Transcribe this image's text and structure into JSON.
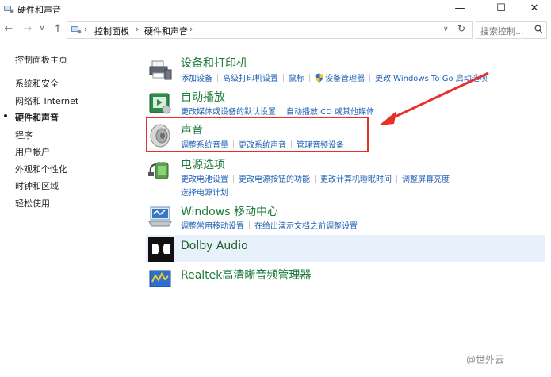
{
  "window": {
    "title": "硬件和声音"
  },
  "address": {
    "crumbs": [
      "控制面板",
      "硬件和声音"
    ]
  },
  "search": {
    "placeholder": "搜索控制..."
  },
  "sidebar": {
    "items": [
      {
        "label": "控制面板主页"
      },
      {
        "label": "系统和安全"
      },
      {
        "label": "网络和 Internet"
      },
      {
        "label": "硬件和声音"
      },
      {
        "label": "程序"
      },
      {
        "label": "用户帐户"
      },
      {
        "label": "外观和个性化"
      },
      {
        "label": "时钟和区域"
      },
      {
        "label": "轻松使用"
      }
    ]
  },
  "categories": {
    "devices": {
      "title": "设备和打印机",
      "links": [
        "添加设备",
        "高级打印机设置",
        "鼠标",
        "设备管理器",
        "更改 Windows To Go 启动选项"
      ]
    },
    "autoplay": {
      "title": "自动播放",
      "links": [
        "更改媒体或设备的默认设置",
        "自动播放 CD 或其他媒体"
      ]
    },
    "sound": {
      "title": "声音",
      "links": [
        "调整系统音量",
        "更改系统声音",
        "管理音频设备"
      ]
    },
    "power": {
      "title": "电源选项",
      "links": [
        "更改电池设置",
        "更改电源按钮的功能",
        "更改计算机睡眠时间",
        "调整屏幕亮度"
      ],
      "links2": [
        "选择电源计划"
      ]
    },
    "mobility": {
      "title": "Windows 移动中心",
      "links": [
        "调整常用移动设置",
        "在给出演示文档之前调整设置"
      ]
    },
    "dolby": {
      "title": "Dolby Audio"
    },
    "realtek": {
      "title": "Realtek高清晰音频管理器"
    }
  },
  "watermark": "@世外云",
  "colors": {
    "link": "#1f5fb3",
    "category_title": "#1a7a3a",
    "highlight": "#e8302a",
    "selected_row": "#e8f1fb"
  }
}
